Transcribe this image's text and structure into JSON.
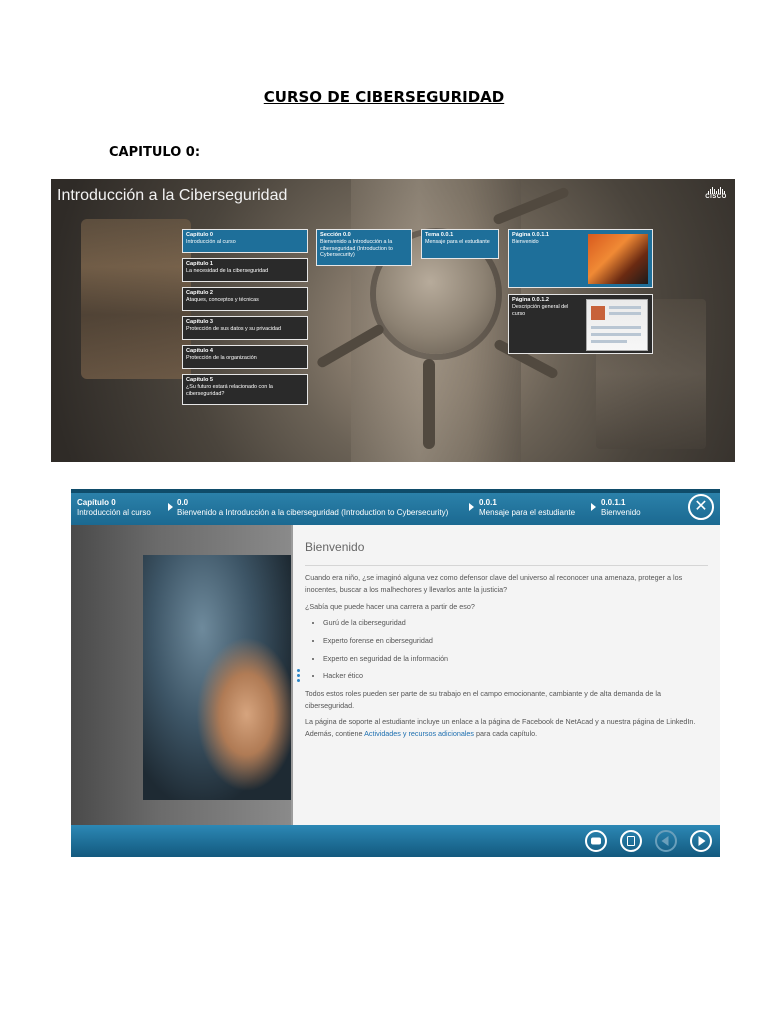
{
  "document": {
    "title": "CURSO DE CIBERSEGURIDAD",
    "chapter_heading": "CAPITULO 0:"
  },
  "course_map": {
    "title": "Introducción a la Ciberseguridad",
    "brand": "CISCO",
    "chapters": [
      {
        "label": "Capítulo 0",
        "text": "Introducción al curso",
        "active": true
      },
      {
        "label": "Capítulo 1",
        "text": "La necesidad de la ciberseguridad",
        "active": false
      },
      {
        "label": "Capítulo 2",
        "text": "Ataques, conceptos y técnicas",
        "active": false
      },
      {
        "label": "Capítulo 3",
        "text": "Protección de sus datos y su privacidad",
        "active": false
      },
      {
        "label": "Capítulo 4",
        "text": "Protección de la organización",
        "active": false
      },
      {
        "label": "Capítulo 5",
        "text": "¿Su futuro estará relacionado con la ciberseguridad?",
        "active": false
      }
    ],
    "section": {
      "label": "Sección 0.0",
      "text": "Bienvenido a Introducción a la ciberseguridad (Introduction to Cybersecurity)"
    },
    "topic": {
      "label": "Tema 0.0.1",
      "text": "Mensaje para el estudiante"
    },
    "pages": [
      {
        "label": "Página 0.0.1.1",
        "text": "Bienvenido"
      },
      {
        "label": "Página 0.0.1.2",
        "text": "Descripción general del curso"
      }
    ]
  },
  "lesson": {
    "breadcrumbs": [
      {
        "label": "Capítulo 0",
        "text": "Introducción al curso"
      },
      {
        "label": "0.0",
        "text": "Bienvenido a Introducción a la ciberseguridad (Introduction to Cybersecurity)"
      },
      {
        "label": "0.0.1",
        "text": "Mensaje para el estudiante"
      },
      {
        "label": "0.0.1.1",
        "text": "Bienvenido"
      }
    ],
    "close_symbol": "✕",
    "heading": "Bienvenido",
    "para1": "Cuando era niño, ¿se imaginó alguna vez como defensor clave del universo al reconocer una amenaza, proteger a los inocentes, buscar a los malhechores y llevarlos ante la justicia?",
    "para2": "¿Sabía que puede hacer una carrera a partir de eso?",
    "roles": [
      "Gurú de la ciberseguridad",
      "Experto forense en ciberseguridad",
      "Experto en seguridad de la información",
      "Hacker ético"
    ],
    "para3": "Todos estos roles pueden ser parte de su trabajo en el campo emocionante, cambiante y de alta demanda de la ciberseguridad.",
    "para4_before": "La página de soporte al estudiante incluye un enlace a la página de Facebook de NetAcad y a nuestra página de LinkedIn. Además, contiene ",
    "para4_link": "Actividades y recursos adicionales",
    "para4_after": " para cada capítulo.",
    "icons": {
      "close": "close-icon",
      "forum": "chat-bubble-icon",
      "bookmark": "bookmark-icon",
      "prev": "arrow-left-icon",
      "next": "arrow-right-icon"
    }
  }
}
